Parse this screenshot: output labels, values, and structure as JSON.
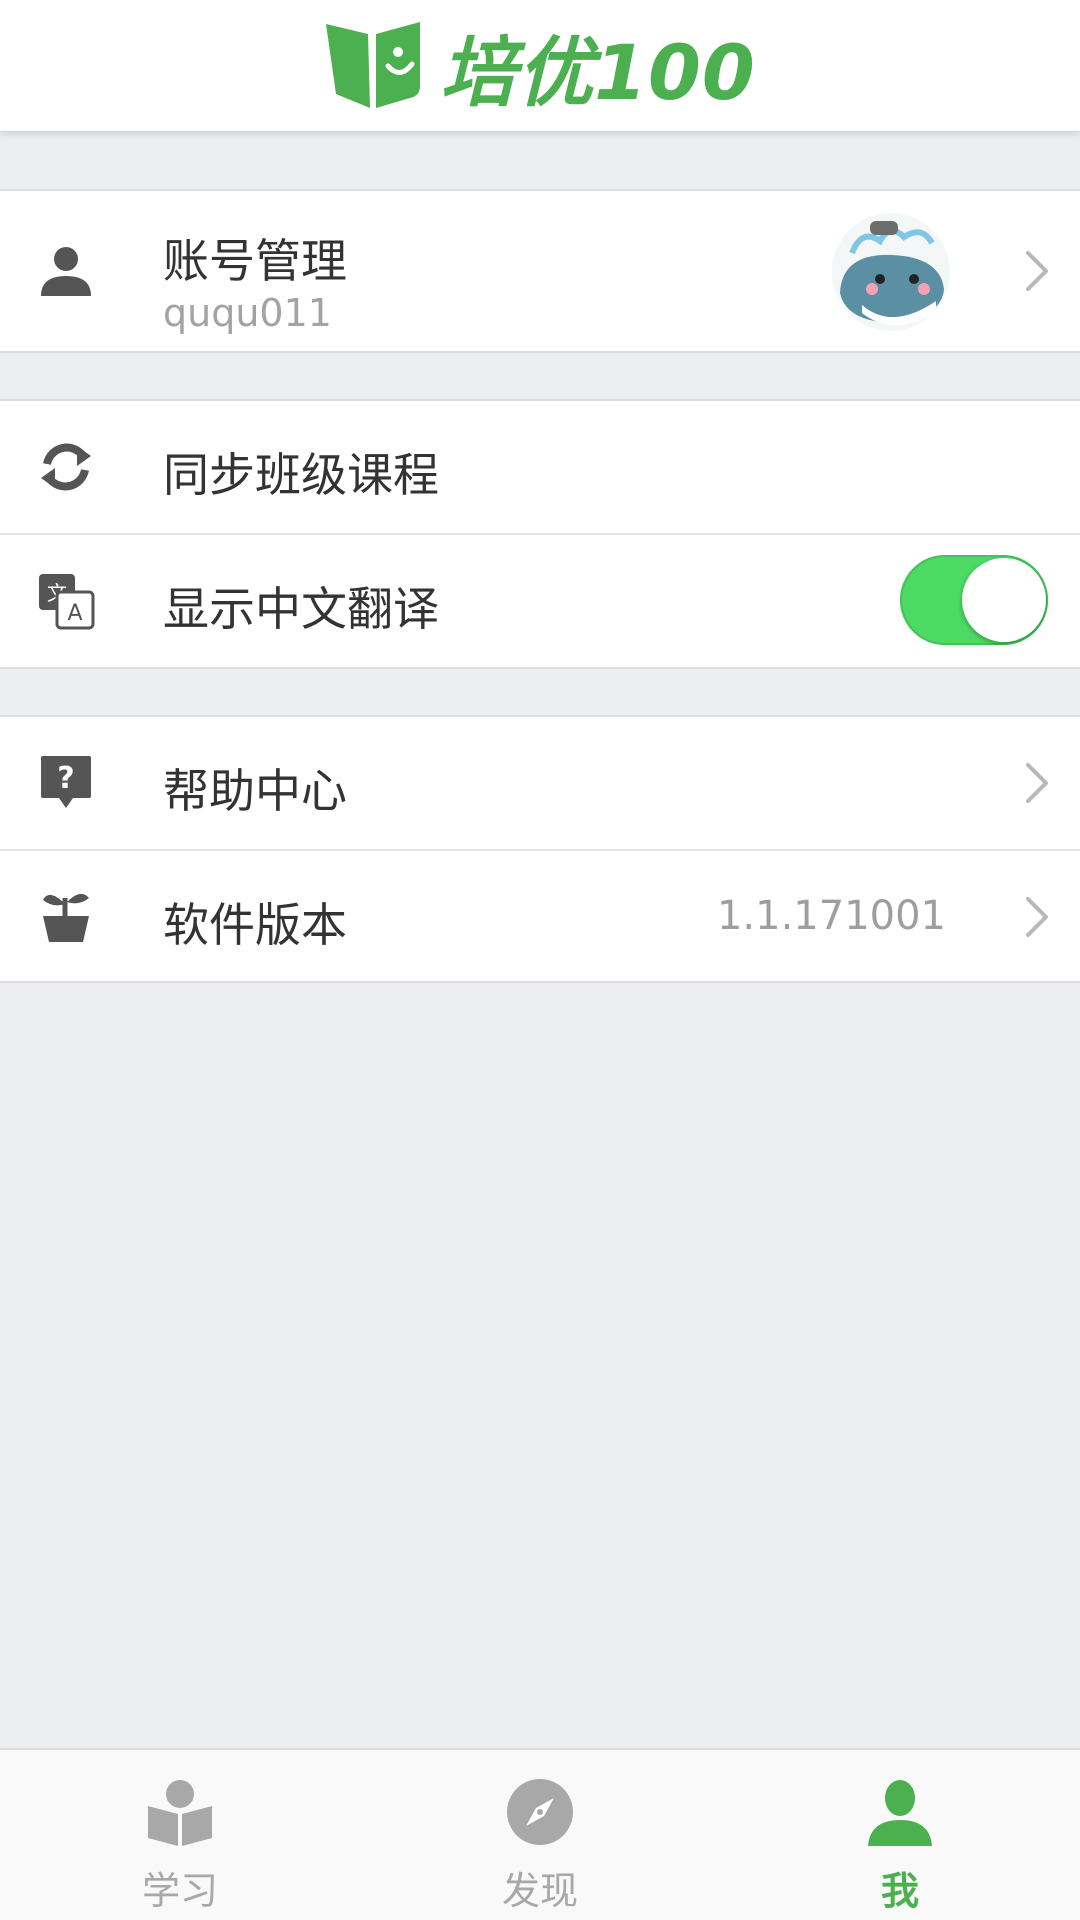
{
  "header": {
    "logo_text": "培优100",
    "brand_color": "#4CAF50"
  },
  "account": {
    "label": "账号管理",
    "username": "ququ011",
    "icon": "person-icon",
    "avatar": "whale-avatar"
  },
  "settings": {
    "sync": {
      "label": "同步班级课程",
      "icon": "sync-icon"
    },
    "translate": {
      "label": "显示中文翻译",
      "icon": "translate-icon",
      "enabled": true
    }
  },
  "more": {
    "help": {
      "label": "帮助中心",
      "icon": "help-icon"
    },
    "version": {
      "label": "软件版本",
      "value": "1.1.171001",
      "icon": "plant-icon"
    }
  },
  "tabbar": {
    "tabs": [
      {
        "label": "学习",
        "icon": "book-reader-icon",
        "active": false
      },
      {
        "label": "发现",
        "icon": "compass-icon",
        "active": false
      },
      {
        "label": "我",
        "icon": "user-icon",
        "active": true
      }
    ],
    "active_color": "#4CAF50",
    "inactive_color": "#A8A8A8"
  },
  "colors": {
    "background": "#ECEDF1",
    "toggle_on": "#4CD964",
    "icon_gray": "#555555"
  }
}
